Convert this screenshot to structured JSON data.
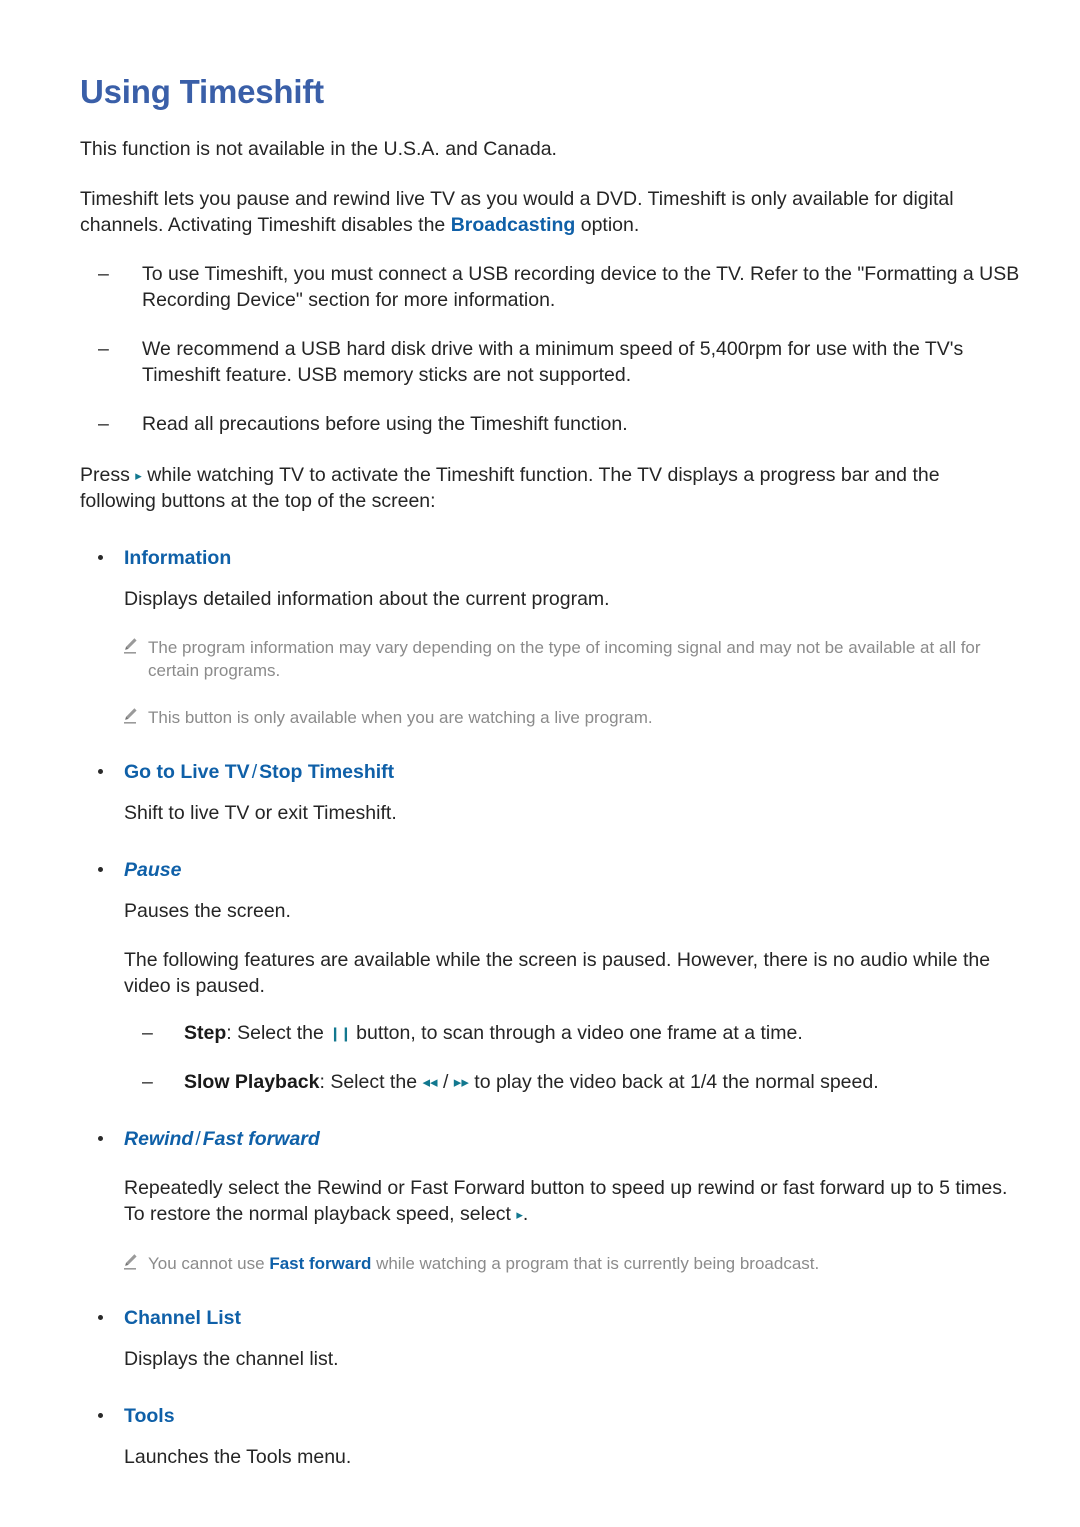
{
  "document": {
    "title": "Using Timeshift",
    "intro_availability": "This function is not available in the U.S.A. and Canada.",
    "intro_paragraph": {
      "before_link": "Timeshift lets you pause and rewind live TV as you would a DVD. Timeshift is only available for digital channels. Activating Timeshift disables the ",
      "link": "Broadcasting",
      "after_link": " option."
    },
    "requirements": [
      "To use Timeshift, you must connect a USB recording device to the TV. Refer to the \"Formatting a USB Recording Device\" section for more information.",
      "We recommend a USB hard disk drive with a minimum speed of 5,400rpm for use with the TV's Timeshift feature. USB memory sticks are not supported.",
      "Read all precautions before using the Timeshift function."
    ],
    "press_paragraph": {
      "before_glyph": "Press ",
      "glyph": "▸",
      "glyph_name": "play-icon",
      "after_glyph": " while watching TV to activate the Timeshift function. The TV displays a progress bar and the following buttons at the top of the screen:"
    },
    "sections": [
      {
        "heading": "Information",
        "description": "Displays detailed information about the current program.",
        "notes": [
          "The program information may vary depending on the type of incoming signal and may not be available at all for certain programs.",
          "This button is only available when you are watching a live program."
        ]
      },
      {
        "heading_parts": [
          "Go to Live TV",
          "Stop Timeshift"
        ],
        "separator": "/",
        "description": "Shift to live TV or exit Timeshift."
      },
      {
        "heading": "Pause",
        "description": "Pauses the screen.",
        "extra_paragraph": "The following features are available while the screen is paused. However, there is no audio while the video is paused.",
        "sub_items": [
          {
            "label": "Step",
            "before_glyph": ": Select the ",
            "glyph": "❙❙",
            "glyph_name": "pause-icon",
            "after_glyph": " button, to scan through a video one frame at a time."
          },
          {
            "label": "Slow Playback",
            "before_glyph": ": Select the ",
            "glyph_rewind": "◂◂",
            "glyph_rewind_name": "rewind-icon",
            "glyph_sep": " / ",
            "glyph_forward": "▸▸",
            "glyph_forward_name": "fast-forward-icon",
            "after_glyph": " to play the video back at 1/4 the normal speed."
          }
        ]
      },
      {
        "heading_parts": [
          "Rewind",
          "Fast forward"
        ],
        "separator": "/",
        "oblique": true,
        "description_before_glyph": "Repeatedly select the Rewind or Fast Forward button to speed up rewind or fast forward up to 5 times. To restore the normal playback speed, select ",
        "description_glyph": "▸",
        "description_glyph_name": "play-icon",
        "description_after_glyph": ".",
        "note_parts": {
          "before_link": "You cannot use ",
          "link": "Fast forward",
          "after_link": " while watching a program that is currently being broadcast."
        }
      },
      {
        "heading": "Channel List",
        "description": "Displays the channel list."
      },
      {
        "heading": "Tools",
        "description": "Launches the Tools menu."
      }
    ],
    "colors": {
      "title_blue": "#3a5fa8",
      "link_blue": "#0f60a8",
      "glyph_teal": "#12788f",
      "note_gray": "#8b8b8b",
      "body_text": "#252525",
      "background": "#ffffff"
    }
  }
}
